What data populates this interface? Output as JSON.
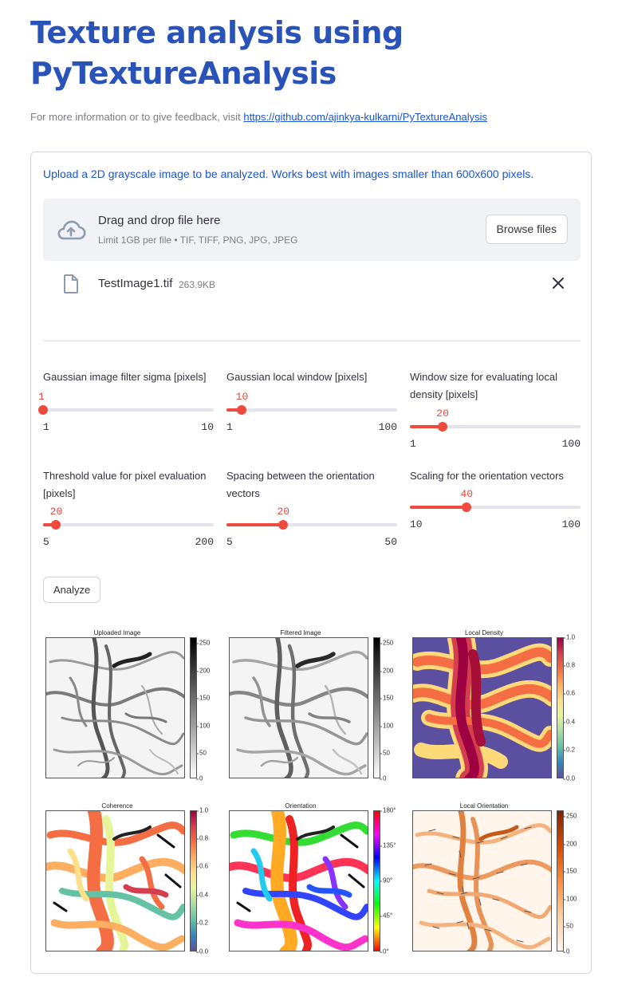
{
  "title": "Texture analysis using PyTextureAnalysis",
  "caption": {
    "text": "For more information or to give feedback, visit ",
    "link": "https://github.com/ajinkya-kulkarni/PyTextureAnalysis"
  },
  "uploader": {
    "label": "Upload a 2D grayscale image to be analyzed. Works best with images smaller than 600x600 pixels.",
    "drop_title": "Drag and drop file here",
    "drop_subtitle": "Limit 1GB per file • TIF, TIFF, PNG, JPG, JPEG",
    "browse_label": "Browse files",
    "cloud_icon": "cloud-upload-icon",
    "file": {
      "name": "TestImage1.tif",
      "size": "263.9KB",
      "icon": "file-icon",
      "remove_icon": "close-icon"
    }
  },
  "sliders": [
    {
      "label": "Gaussian image filter sigma [pixels]",
      "value": "1",
      "min": "1",
      "max": "10",
      "fraction": 0.0
    },
    {
      "label": "Gaussian local window [pixels]",
      "value": "10",
      "min": "1",
      "max": "100",
      "fraction": 0.091
    },
    {
      "label": "Window size for evaluating local density [pixels]",
      "value": "20",
      "min": "1",
      "max": "100",
      "fraction": 0.192
    },
    {
      "label": "Threshold value for pixel evaluation [pixels]",
      "value": "20",
      "min": "5",
      "max": "200",
      "fraction": 0.077
    },
    {
      "label": "Spacing between the orientation vectors",
      "value": "20",
      "min": "5",
      "max": "50",
      "fraction": 0.333
    },
    {
      "label": "Scaling for the orientation vectors",
      "value": "40",
      "min": "10",
      "max": "100",
      "fraction": 0.333
    }
  ],
  "analyze_label": "Analyze",
  "plots": [
    {
      "title": "Uploaded Image",
      "colormap": "gray",
      "ticks": [
        "250",
        "200",
        "150",
        "100",
        "50",
        "0"
      ]
    },
    {
      "title": "Filtered Image",
      "colormap": "gray",
      "ticks": [
        "250",
        "200",
        "150",
        "100",
        "50",
        "0"
      ]
    },
    {
      "title": "Local Density",
      "colormap": "spectral",
      "ticks": [
        "1.0",
        "0.8",
        "0.6",
        "0.4",
        "0.2",
        "0.0"
      ]
    },
    {
      "title": "Coherence",
      "colormap": "spectral",
      "ticks": [
        "1.0",
        "0.8",
        "0.6",
        "0.4",
        "0.2",
        "0.0"
      ]
    },
    {
      "title": "Orientation",
      "colormap": "hsv",
      "ticks": [
        "180°",
        "135°",
        "90°",
        "45°",
        "0°"
      ]
    },
    {
      "title": "Local Orientation",
      "colormap": "oranges",
      "ticks": [
        "250",
        "200",
        "150",
        "100",
        "50",
        "0"
      ]
    }
  ],
  "colors": {
    "accent": "#2953b8",
    "slider": "#ee4a3e",
    "link": "#1a53d6"
  }
}
